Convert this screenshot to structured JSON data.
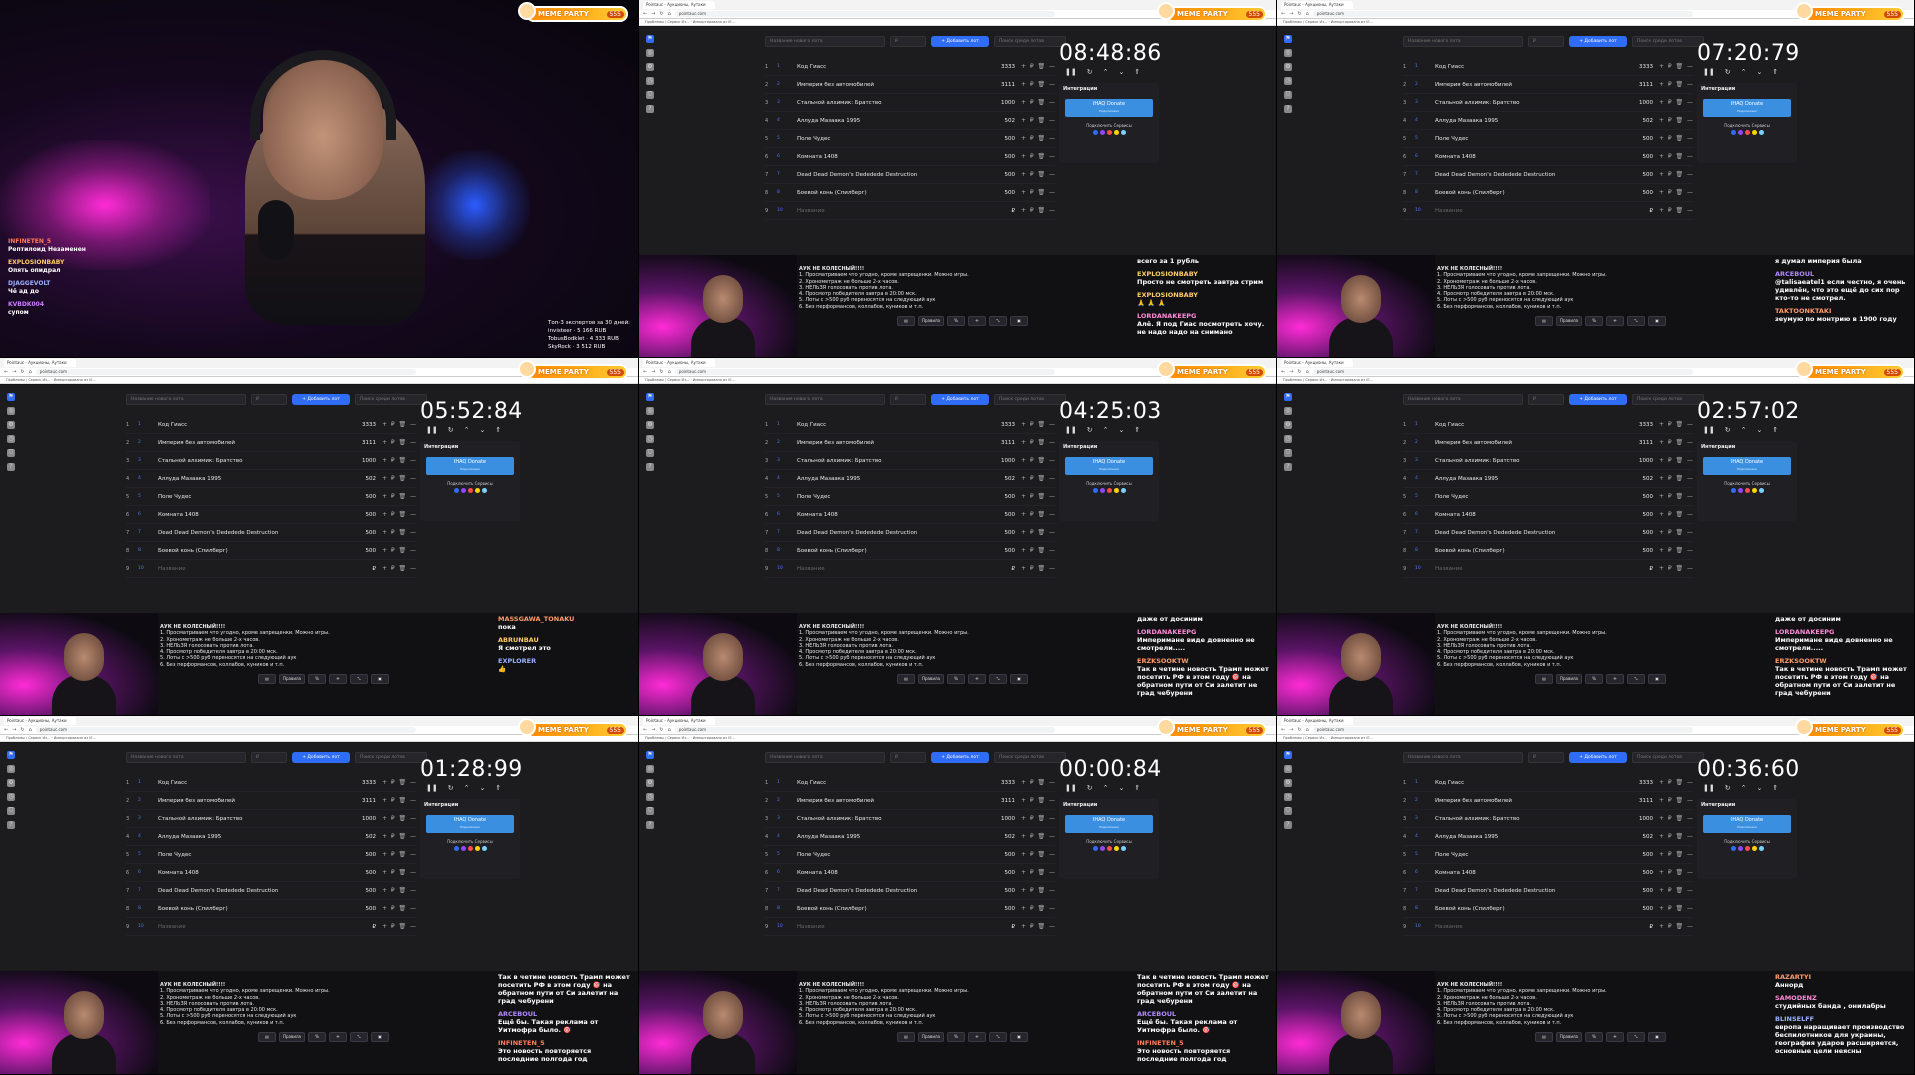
{
  "cam": {
    "badge": {
      "label": "MEME PARTY",
      "value": "555"
    },
    "chat": [
      {
        "user": "INFINETEN_5",
        "text": "Рептилоид Незаменен",
        "color": "#ff7d5a"
      },
      {
        "user": "EXPLOSIONBABY",
        "text": "Опять опидрал",
        "color": "#ffcc66"
      },
      {
        "user": "DJAGGEVOLT",
        "text": "Чё ад до",
        "color": "#9ab0ff"
      },
      {
        "user": "KVBDK004",
        "text": "супом",
        "color": "#d07bff"
      }
    ],
    "stats": [
      "Топ-3 экспертов за 30 дней:",
      "invisteer · 5 166 RUB",
      "TobusBodklet · 4 333 RUB",
      "SkyRock · 3 512 RUB"
    ]
  },
  "browser": {
    "tab": "Pointauc - Аукционы, Аутаки",
    "url": "pointauc.com",
    "bookmarks": "Проблемы / Сервис Из... · Импортировано из IE..."
  },
  "app": {
    "lot_placeholder": "Название нового лота",
    "sum_placeholder": "₽",
    "add_button": "+ Добавить лот",
    "search_placeholder": "Поиск среди лотов",
    "integrations_title": "Интеграции",
    "donate_title": "IHAQ Donate",
    "donate_sub": "Подключено",
    "connect_label": "Подключить Сервисы",
    "lots": [
      {
        "n": "1",
        "rank": "1",
        "name": "Код Гиасс",
        "sum": "3333"
      },
      {
        "n": "2",
        "rank": "2",
        "name": "Империя без автомобилей",
        "sum": "3111"
      },
      {
        "n": "3",
        "rank": "3",
        "name": "Стальной алхимик: Братство",
        "sum": "1000"
      },
      {
        "n": "4",
        "rank": "4",
        "name": "Аллуда Мазаака 1995",
        "sum": "502"
      },
      {
        "n": "5",
        "rank": "5",
        "name": "Поле Чудес",
        "sum": "500"
      },
      {
        "n": "6",
        "rank": "6",
        "name": "Комната 1408",
        "sum": "500"
      },
      {
        "n": "7",
        "rank": "7",
        "name": "Dead Dead Demon's Dededede Destruction",
        "sum": "500"
      },
      {
        "n": "8",
        "rank": "8",
        "name": "Боевой конь (Спилберг)",
        "sum": "500"
      },
      {
        "n": "9",
        "rank": "10",
        "name": "Название",
        "sum": "₽"
      }
    ],
    "rules_title": "АУК НЕ КОЛЕСНЫЙ!!!!",
    "rules": [
      "1. Просматриваем что угодно, кроме запрещенки. Можно игры.",
      "2. Хронометраж не больше 2-х часов.",
      "3. НЕЛЬЗЯ голосовать против лота.",
      "4. Просмотр победителя завтра в 20:00 мск.",
      "5. Лоты с >500 руб переносятся на следующий аук",
      "6. Без перформансов, коллабов, куников и т.п."
    ],
    "toolbar": [
      "▤",
      "Правила",
      "%",
      "✛",
      "⤡",
      "▣"
    ]
  },
  "screens": [
    {
      "timer": "08:48:86",
      "chat": [
        {
          "user": "",
          "text": "всего за 1 рубль",
          "color": "#fff"
        },
        {
          "user": "EXPLOSIONBABY",
          "text": "Просто не смотреть завтра стрим",
          "color": "#ffcc66"
        },
        {
          "user": "EXPLOSIONBABY",
          "text": "🙏 🙏 🙏",
          "color": "#ffcc66"
        },
        {
          "user": "LORDANAKEEPG",
          "text": "Алё. Я под Гиас посмотреть хочу. не надо надо на снимано",
          "color": "#ff8ad8"
        }
      ]
    },
    {
      "timer": "07:20:79",
      "chat": [
        {
          "user": "",
          "text": "я думал империя была",
          "color": "#fff"
        },
        {
          "user": "ARCEBOUL",
          "text": "@talisaeatel1 если честно, я очень удивлён, что это ещё до сих пор кто-то не смотрел.",
          "color": "#b08aff"
        },
        {
          "user": "TAKTOONKTAKI",
          "text": "зеумую по монтрию в 1900 году",
          "color": "#ff9a6b"
        }
      ]
    },
    {
      "timer": "05:52:84",
      "chat": [
        {
          "user": "MASSGAWA_TONAKU",
          "text": "пока",
          "color": "#ff9a6b"
        },
        {
          "user": "ABRUNBAU",
          "text": "Я смотрел это",
          "color": "#ffcc66"
        },
        {
          "user": "EXPLORER",
          "text": "👍",
          "color": "#9ab0ff"
        }
      ]
    },
    {
      "timer": "04:25:03",
      "chat": [
        {
          "user": "",
          "text": "даже от досиним",
          "color": "#fff"
        },
        {
          "user": "LORDANAKEEPG",
          "text": "Империмане виде довненно не смотрели.....",
          "color": "#ff8ad8"
        },
        {
          "user": "ERZKSOOKTW",
          "text": "Так в четине новость Трамп может посетить РФ в этом году 🎯 на обратном пути от Си залетит не град чебурени",
          "color": "#ff9a6b"
        }
      ]
    },
    {
      "timer": "02:57:02",
      "chat": [
        {
          "user": "",
          "text": "даже от досиним",
          "color": "#fff"
        },
        {
          "user": "LORDANAKEEPG",
          "text": "Империмане виде довненно не смотрели.....",
          "color": "#ff8ad8"
        },
        {
          "user": "ERZKSOOKTW",
          "text": "Так в четине новость Трамп может посетить РФ в этом году 🎯 на обратном пути от Си залетит не град чебурени",
          "color": "#ff9a6b"
        }
      ]
    },
    {
      "timer": "01:28:99",
      "chat": [
        {
          "user": "",
          "text": "Так в четине новость Трамп может посетить РФ в этом году 🎯 на обратном пути от Си залетит на град чебурени",
          "color": "#fff"
        },
        {
          "user": "ARCEBOUL",
          "text": "Ещё бы. Такая реклама от Уитмофра было. 🎯",
          "color": "#b08aff"
        },
        {
          "user": "INFINETEN_5",
          "text": "Это новость повторяется последние полгода год",
          "color": "#ff7d5a"
        }
      ]
    },
    {
      "timer": "00:00:84",
      "chat": [
        {
          "user": "",
          "text": "Так в четине новость Трамп может посетить РФ в этом году 🎯 на обратном пути от Си залетит на град чебурени",
          "color": "#fff"
        },
        {
          "user": "ARCEBOUL",
          "text": "Ещё бы. Такая реклама от Уитмофра было. 🎯",
          "color": "#b08aff"
        },
        {
          "user": "INFINETEN_5",
          "text": "Это новость повторяется последние полгода год",
          "color": "#ff7d5a"
        }
      ]
    },
    {
      "timer": "00:36:60",
      "chat": [
        {
          "user": "RAZARTYI",
          "text": "Аннорд",
          "color": "#ff9a6b"
        },
        {
          "user": "SAMODENZ",
          "text": "студийных банда , онилабры",
          "color": "#ff8ad8"
        },
        {
          "user": "BLINSELFF",
          "text": "европа наращивает производство беспилотников для украины, география ударов расширяется, основные цели неясны",
          "color": "#9ab0ff"
        }
      ]
    }
  ]
}
